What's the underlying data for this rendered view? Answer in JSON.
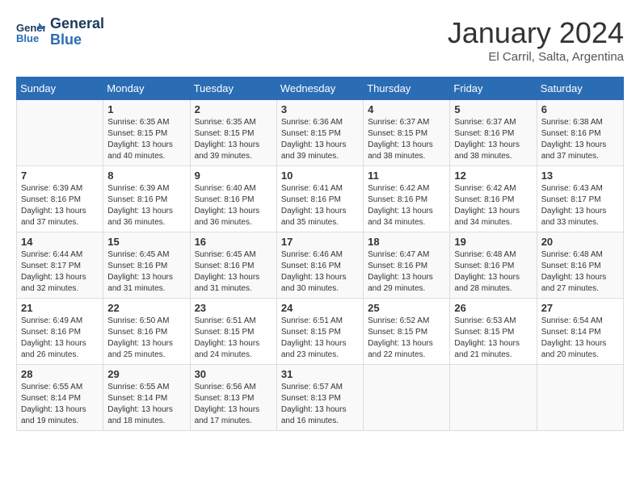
{
  "header": {
    "logo_line1": "General",
    "logo_line2": "Blue",
    "month": "January 2024",
    "location": "El Carril, Salta, Argentina"
  },
  "weekdays": [
    "Sunday",
    "Monday",
    "Tuesday",
    "Wednesday",
    "Thursday",
    "Friday",
    "Saturday"
  ],
  "weeks": [
    [
      {
        "day": "",
        "sunrise": "",
        "sunset": "",
        "daylight": ""
      },
      {
        "day": "1",
        "sunrise": "Sunrise: 6:35 AM",
        "sunset": "Sunset: 8:15 PM",
        "daylight": "Daylight: 13 hours and 40 minutes."
      },
      {
        "day": "2",
        "sunrise": "Sunrise: 6:35 AM",
        "sunset": "Sunset: 8:15 PM",
        "daylight": "Daylight: 13 hours and 39 minutes."
      },
      {
        "day": "3",
        "sunrise": "Sunrise: 6:36 AM",
        "sunset": "Sunset: 8:15 PM",
        "daylight": "Daylight: 13 hours and 39 minutes."
      },
      {
        "day": "4",
        "sunrise": "Sunrise: 6:37 AM",
        "sunset": "Sunset: 8:15 PM",
        "daylight": "Daylight: 13 hours and 38 minutes."
      },
      {
        "day": "5",
        "sunrise": "Sunrise: 6:37 AM",
        "sunset": "Sunset: 8:16 PM",
        "daylight": "Daylight: 13 hours and 38 minutes."
      },
      {
        "day": "6",
        "sunrise": "Sunrise: 6:38 AM",
        "sunset": "Sunset: 8:16 PM",
        "daylight": "Daylight: 13 hours and 37 minutes."
      }
    ],
    [
      {
        "day": "7",
        "sunrise": "Sunrise: 6:39 AM",
        "sunset": "Sunset: 8:16 PM",
        "daylight": "Daylight: 13 hours and 37 minutes."
      },
      {
        "day": "8",
        "sunrise": "Sunrise: 6:39 AM",
        "sunset": "Sunset: 8:16 PM",
        "daylight": "Daylight: 13 hours and 36 minutes."
      },
      {
        "day": "9",
        "sunrise": "Sunrise: 6:40 AM",
        "sunset": "Sunset: 8:16 PM",
        "daylight": "Daylight: 13 hours and 36 minutes."
      },
      {
        "day": "10",
        "sunrise": "Sunrise: 6:41 AM",
        "sunset": "Sunset: 8:16 PM",
        "daylight": "Daylight: 13 hours and 35 minutes."
      },
      {
        "day": "11",
        "sunrise": "Sunrise: 6:42 AM",
        "sunset": "Sunset: 8:16 PM",
        "daylight": "Daylight: 13 hours and 34 minutes."
      },
      {
        "day": "12",
        "sunrise": "Sunrise: 6:42 AM",
        "sunset": "Sunset: 8:16 PM",
        "daylight": "Daylight: 13 hours and 34 minutes."
      },
      {
        "day": "13",
        "sunrise": "Sunrise: 6:43 AM",
        "sunset": "Sunset: 8:17 PM",
        "daylight": "Daylight: 13 hours and 33 minutes."
      }
    ],
    [
      {
        "day": "14",
        "sunrise": "Sunrise: 6:44 AM",
        "sunset": "Sunset: 8:17 PM",
        "daylight": "Daylight: 13 hours and 32 minutes."
      },
      {
        "day": "15",
        "sunrise": "Sunrise: 6:45 AM",
        "sunset": "Sunset: 8:16 PM",
        "daylight": "Daylight: 13 hours and 31 minutes."
      },
      {
        "day": "16",
        "sunrise": "Sunrise: 6:45 AM",
        "sunset": "Sunset: 8:16 PM",
        "daylight": "Daylight: 13 hours and 31 minutes."
      },
      {
        "day": "17",
        "sunrise": "Sunrise: 6:46 AM",
        "sunset": "Sunset: 8:16 PM",
        "daylight": "Daylight: 13 hours and 30 minutes."
      },
      {
        "day": "18",
        "sunrise": "Sunrise: 6:47 AM",
        "sunset": "Sunset: 8:16 PM",
        "daylight": "Daylight: 13 hours and 29 minutes."
      },
      {
        "day": "19",
        "sunrise": "Sunrise: 6:48 AM",
        "sunset": "Sunset: 8:16 PM",
        "daylight": "Daylight: 13 hours and 28 minutes."
      },
      {
        "day": "20",
        "sunrise": "Sunrise: 6:48 AM",
        "sunset": "Sunset: 8:16 PM",
        "daylight": "Daylight: 13 hours and 27 minutes."
      }
    ],
    [
      {
        "day": "21",
        "sunrise": "Sunrise: 6:49 AM",
        "sunset": "Sunset: 8:16 PM",
        "daylight": "Daylight: 13 hours and 26 minutes."
      },
      {
        "day": "22",
        "sunrise": "Sunrise: 6:50 AM",
        "sunset": "Sunset: 8:16 PM",
        "daylight": "Daylight: 13 hours and 25 minutes."
      },
      {
        "day": "23",
        "sunrise": "Sunrise: 6:51 AM",
        "sunset": "Sunset: 8:15 PM",
        "daylight": "Daylight: 13 hours and 24 minutes."
      },
      {
        "day": "24",
        "sunrise": "Sunrise: 6:51 AM",
        "sunset": "Sunset: 8:15 PM",
        "daylight": "Daylight: 13 hours and 23 minutes."
      },
      {
        "day": "25",
        "sunrise": "Sunrise: 6:52 AM",
        "sunset": "Sunset: 8:15 PM",
        "daylight": "Daylight: 13 hours and 22 minutes."
      },
      {
        "day": "26",
        "sunrise": "Sunrise: 6:53 AM",
        "sunset": "Sunset: 8:15 PM",
        "daylight": "Daylight: 13 hours and 21 minutes."
      },
      {
        "day": "27",
        "sunrise": "Sunrise: 6:54 AM",
        "sunset": "Sunset: 8:14 PM",
        "daylight": "Daylight: 13 hours and 20 minutes."
      }
    ],
    [
      {
        "day": "28",
        "sunrise": "Sunrise: 6:55 AM",
        "sunset": "Sunset: 8:14 PM",
        "daylight": "Daylight: 13 hours and 19 minutes."
      },
      {
        "day": "29",
        "sunrise": "Sunrise: 6:55 AM",
        "sunset": "Sunset: 8:14 PM",
        "daylight": "Daylight: 13 hours and 18 minutes."
      },
      {
        "day": "30",
        "sunrise": "Sunrise: 6:56 AM",
        "sunset": "Sunset: 8:13 PM",
        "daylight": "Daylight: 13 hours and 17 minutes."
      },
      {
        "day": "31",
        "sunrise": "Sunrise: 6:57 AM",
        "sunset": "Sunset: 8:13 PM",
        "daylight": "Daylight: 13 hours and 16 minutes."
      },
      {
        "day": "",
        "sunrise": "",
        "sunset": "",
        "daylight": ""
      },
      {
        "day": "",
        "sunrise": "",
        "sunset": "",
        "daylight": ""
      },
      {
        "day": "",
        "sunrise": "",
        "sunset": "",
        "daylight": ""
      }
    ]
  ]
}
